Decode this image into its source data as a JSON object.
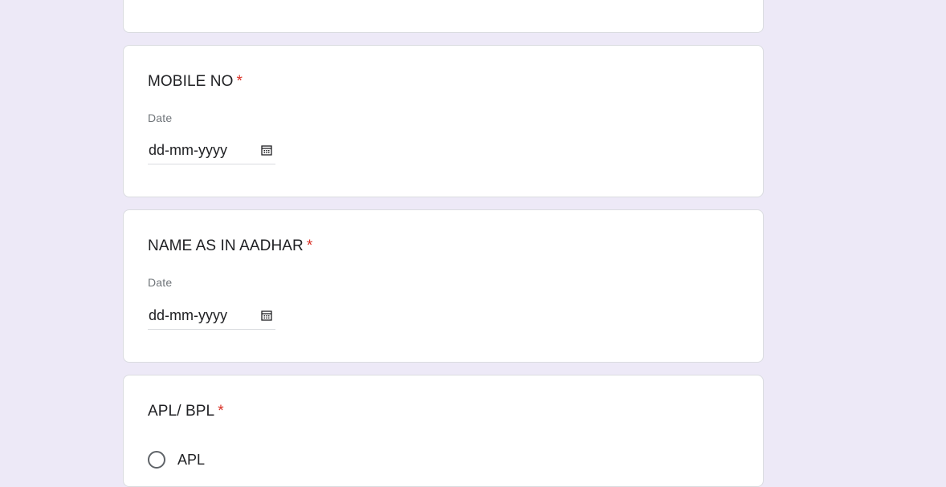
{
  "questions": {
    "mobile": {
      "title": "MOBILE NO",
      "required_mark": "*",
      "field_label": "Date",
      "date_placeholder": "dd-mm-yyyy",
      "icon": "calendar-icon"
    },
    "name": {
      "title": "NAME AS IN AADHAR",
      "required_mark": "*",
      "field_label": "Date",
      "date_placeholder": "dd-mm-yyyy",
      "icon": "calendar-icon"
    },
    "apl_bpl": {
      "title": "APL/ BPL",
      "required_mark": "*",
      "options": [
        "APL"
      ]
    }
  },
  "colors": {
    "background": "#ede9f7",
    "card": "#ffffff",
    "required": "#d93025",
    "label": "#70757a"
  }
}
